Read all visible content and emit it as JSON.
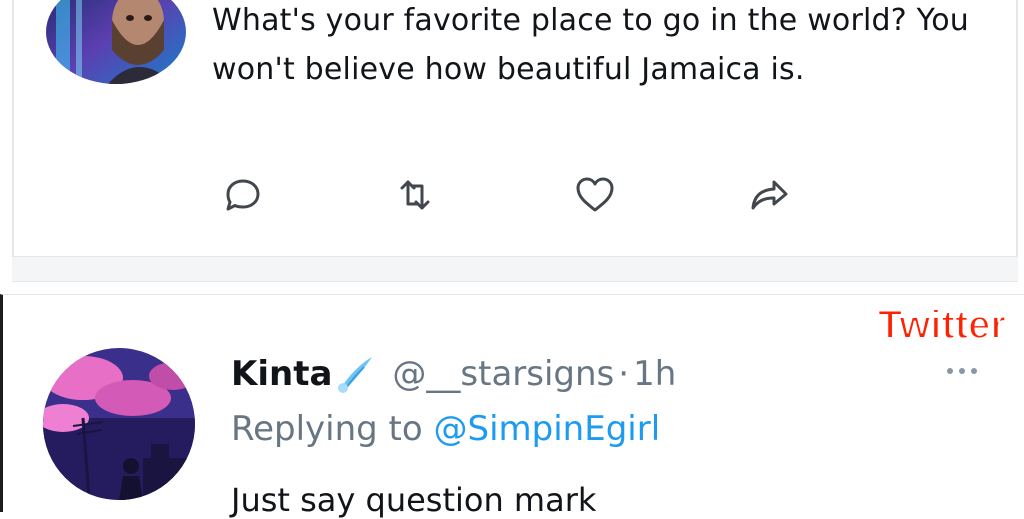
{
  "top_tweet": {
    "text": "What's your favorite place to go in the world? You won't believe how beautiful Jamaica is.",
    "actions": [
      {
        "name": "reply",
        "icon": "reply-icon"
      },
      {
        "name": "retweet",
        "icon": "retweet-icon"
      },
      {
        "name": "like",
        "icon": "heart-icon"
      },
      {
        "name": "share",
        "icon": "share-icon"
      }
    ]
  },
  "watermark": "Twitter",
  "reply_tweet": {
    "display_name": "Kinta",
    "name_emoji": "comet-icon",
    "handle": "@__starsigns",
    "separator": "·",
    "time": "1h",
    "replying_prefix": "Replying to",
    "replying_to": "@SimpinEgirl",
    "text": "Just say question mark"
  },
  "colors": {
    "text": "#111418",
    "secondary": "#687684",
    "link": "#1d9bf0",
    "watermark": "#ff2200"
  }
}
